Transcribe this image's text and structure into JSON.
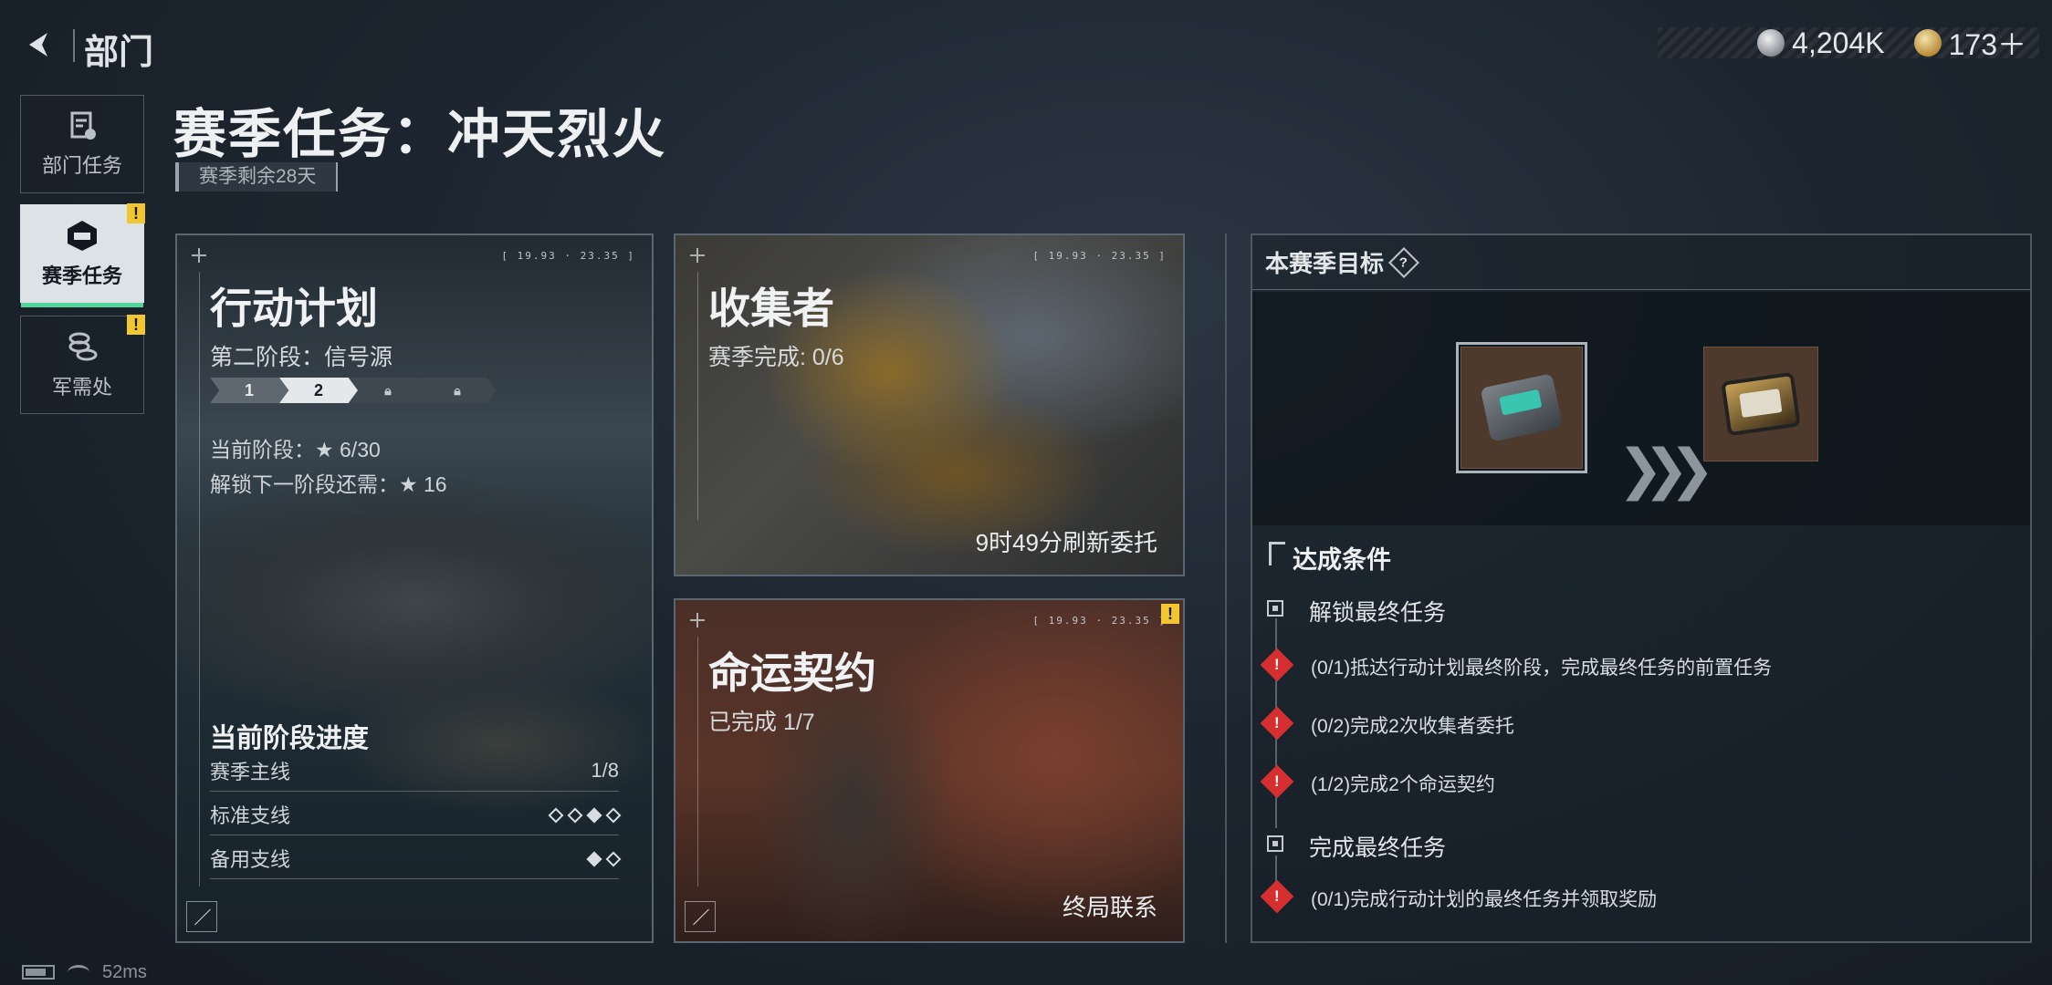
{
  "topbar": {
    "title": "部门",
    "currency_silver": "4,204K",
    "currency_gold": "173＋"
  },
  "sidebar": {
    "items": [
      {
        "label": "部门任务",
        "active": false,
        "warn": false
      },
      {
        "label": "赛季任务",
        "active": true,
        "warn": true
      },
      {
        "label": "军需处",
        "active": false,
        "warn": true
      }
    ],
    "warn_mark": "!"
  },
  "header": {
    "title": "赛季任务：冲天烈火",
    "remaining": "赛季剩余28天"
  },
  "cards": {
    "operation": {
      "title": "行动计划",
      "subtitle": "第二阶段：信号源",
      "stages": [
        "1",
        "2"
      ],
      "stat1": "当前阶段：★ 6/30",
      "stat2": "解锁下一阶段还需：★ 16",
      "progress_title": "当前阶段进度",
      "rows": [
        {
          "label": "赛季主线",
          "value": "1/8"
        },
        {
          "label": "标准支线",
          "diamonds": [
            0,
            0,
            1,
            0
          ]
        },
        {
          "label": "备用支线",
          "diamonds": [
            1,
            0
          ]
        }
      ],
      "coord": "[ 19.93 · 23.35 ]"
    },
    "collector": {
      "title": "收集者",
      "subtitle": "赛季完成: 0/6",
      "refresh": "9时49分刷新委托",
      "coord": "[ 19.93 · 23.35 ]"
    },
    "fate": {
      "title": "命运契约",
      "subtitle": "已完成 1/7",
      "footer": "终局联系",
      "coord": "[ 19.93 · 23.35 ]"
    }
  },
  "goal": {
    "title": "本赛季目标",
    "help": "?",
    "conditions_title": "达成条件",
    "groups": [
      {
        "label": "解锁最终任务",
        "reqs": [
          "(0/1)抵达行动计划最终阶段，完成最终任务的前置任务",
          "(0/2)完成2次收集者委托",
          "(1/2)完成2个命运契约"
        ]
      },
      {
        "label": "完成最终任务",
        "reqs": [
          "(0/1)完成行动计划的最终任务并领取奖励"
        ]
      }
    ],
    "alert_mark": "!",
    "arrows": "❯❯❯"
  },
  "status": {
    "ping": "52ms"
  },
  "colors": {
    "accent_green": "#52d69a",
    "warn_yellow": "#f2c630",
    "alert_red": "#d62f2f"
  }
}
